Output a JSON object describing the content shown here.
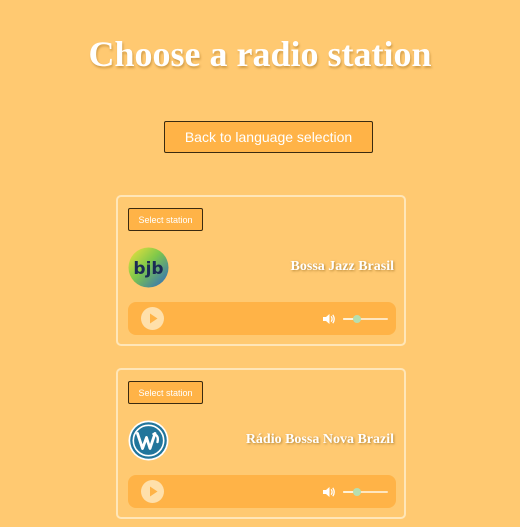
{
  "page": {
    "title": "Choose a radio station",
    "back_label": "Back to language selection"
  },
  "colors": {
    "background": "#ffc971",
    "button": "#ffb347",
    "card_border": "#ffe6b8",
    "text": "#ffffff"
  },
  "stations": [
    {
      "select_label": "Select station",
      "name": "Bossa Jazz Brasil",
      "logo_icon": "bjb-logo",
      "logo_text": "bjb",
      "volume_level": 0.3
    },
    {
      "select_label": "Select station",
      "name": "Rádio Bossa Nova Brazil",
      "logo_icon": "wordpress-logo",
      "volume_level": 0.3
    }
  ]
}
